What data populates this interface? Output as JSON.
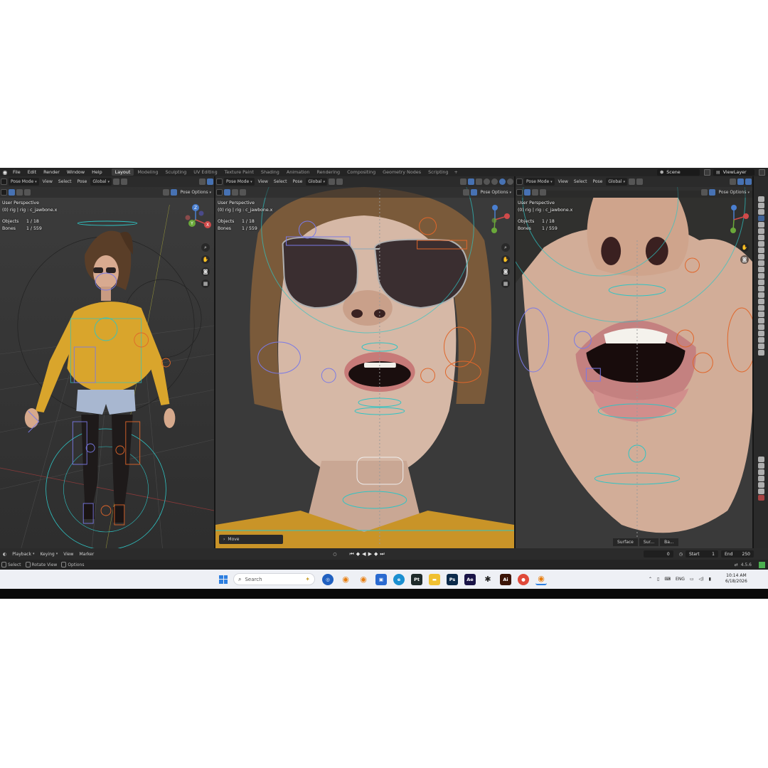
{
  "topbar": {
    "menus": [
      "File",
      "Edit",
      "Render",
      "Window",
      "Help"
    ],
    "workspaces": [
      "Layout",
      "Modeling",
      "Sculpting",
      "UV Editing",
      "Texture Paint",
      "Shading",
      "Animation",
      "Rendering",
      "Compositing",
      "Geometry Nodes",
      "Scripting"
    ],
    "active_workspace": "Layout",
    "plus": "+",
    "scene": "Scene",
    "view_layer": "ViewLayer"
  },
  "viewport_header": {
    "mode": "Pose Mode",
    "menus": [
      "View",
      "Select",
      "Pose"
    ],
    "transform": "Global",
    "pose_options": "Pose Options"
  },
  "viewports": [
    {
      "perspective": "User Perspective",
      "object": "(0) rig | rig : c_jawbone.x",
      "objects_label": "Objects",
      "objects_value": "1 / 18",
      "bones_label": "Bones",
      "bones_value": "1 / 559"
    },
    {
      "perspective": "User Perspective",
      "object": "(0) rig | rig : c_jawbone.x",
      "objects_label": "Objects",
      "objects_value": "1 / 18",
      "bones_label": "Bones",
      "bones_value": "1 / 559"
    },
    {
      "perspective": "User Perspective",
      "object": "(0) rig | rig : c_jawbone.x",
      "objects_label": "Objects",
      "objects_value": "1 / 18",
      "bones_label": "Bones",
      "bones_value": "1 / 559"
    }
  ],
  "gizmo": {
    "x": "X",
    "y": "Y",
    "z": "Z"
  },
  "move_panel": "Move",
  "bottom_tabs": [
    "Surface",
    "Sur...",
    "Ba..."
  ],
  "timeline": {
    "menus": [
      "Playback",
      "Keying",
      "View",
      "Marker"
    ],
    "current_frame": "0",
    "start_label": "Start",
    "start_value": "1",
    "end_label": "End",
    "end_value": "250"
  },
  "statusbar": {
    "items": [
      "Select",
      "Rotate View",
      "Options"
    ],
    "version": "4.5.6"
  },
  "taskbar": {
    "search_placeholder": "Search",
    "apps": [
      {
        "label": "Pt",
        "color": "#1e2a2a"
      },
      {
        "label": "Ps",
        "color": "#0b2a4a"
      },
      {
        "label": "Ae",
        "color": "#1a1447"
      },
      {
        "label": "Ai",
        "color": "#3b1406"
      }
    ],
    "lang": "ENG",
    "time": "10:14 AM",
    "date": "6/18/2026"
  },
  "colors": {
    "accent_blue": "#4772b3",
    "bone_cyan": "#2ec4c4",
    "bone_orange": "#e0662a",
    "bone_purple": "#7a7ae6"
  }
}
